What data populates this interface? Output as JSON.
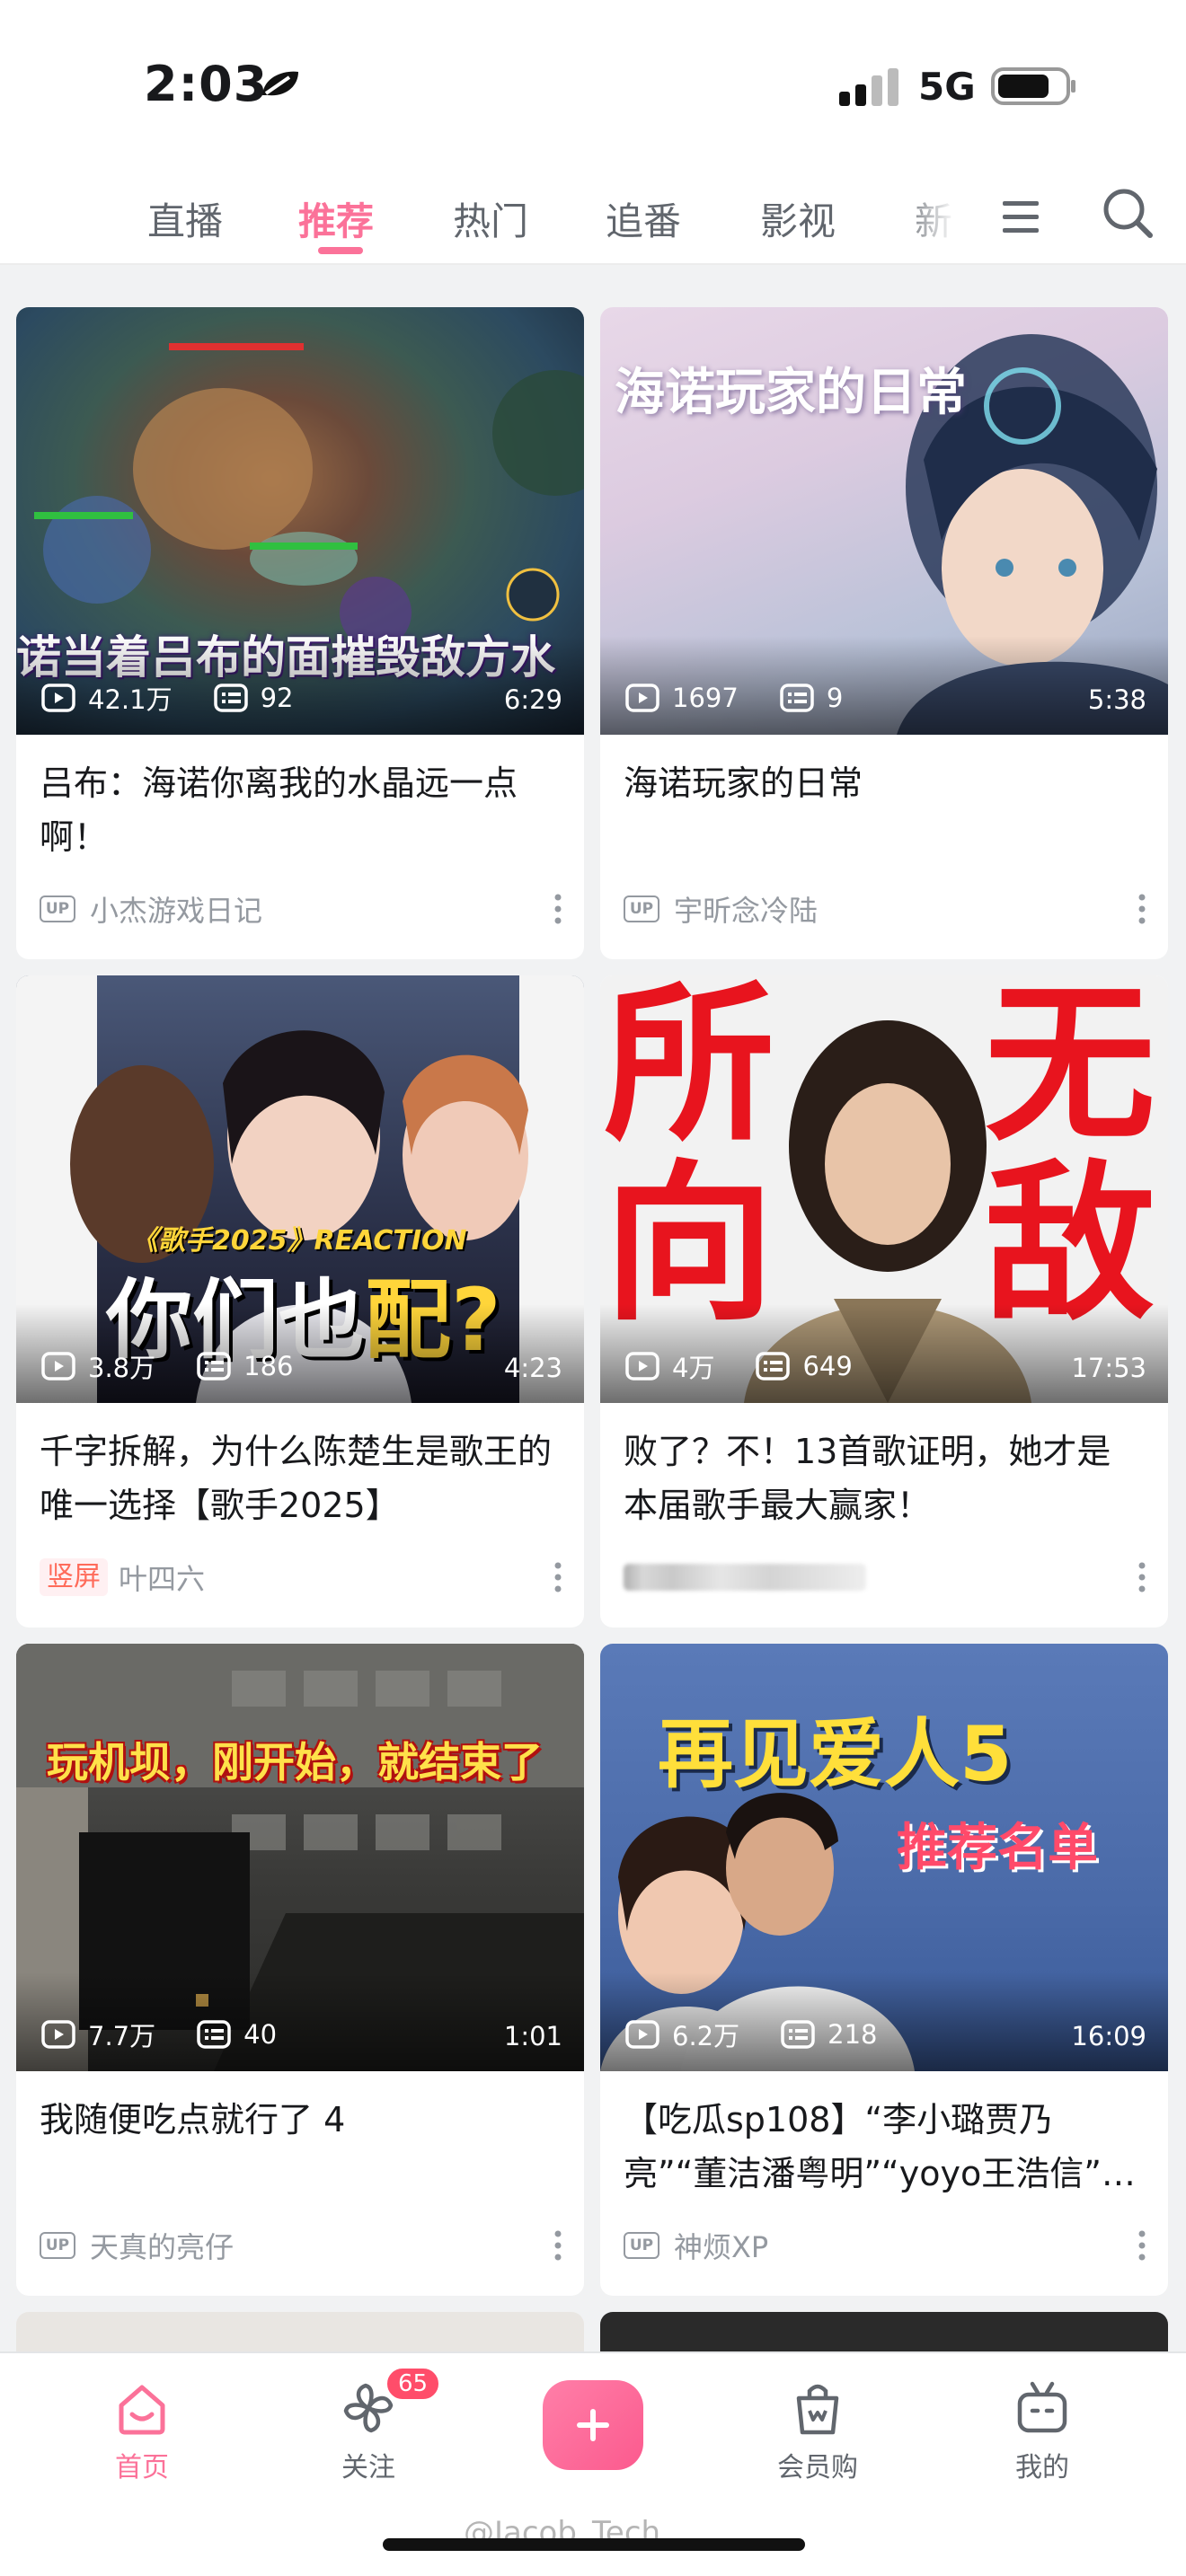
{
  "status_bar": {
    "time": "2:03",
    "network": "5G"
  },
  "top_nav": {
    "tabs": [
      {
        "label": "直播",
        "active": false
      },
      {
        "label": "推荐",
        "active": true
      },
      {
        "label": "热门",
        "active": false
      },
      {
        "label": "追番",
        "active": false
      },
      {
        "label": "影视",
        "active": false
      },
      {
        "label": "新",
        "active": false
      }
    ],
    "menu_icon": "hamburger-icon",
    "search_icon": "search-icon"
  },
  "cards": [
    {
      "views": "42.1万",
      "comments": "92",
      "duration": "6:29",
      "title": "吕布：海诺你离我的水晶远一点啊！",
      "author": "小杰游戏日记",
      "badge": "UP",
      "overlay_text": "诺当着吕布的面摧毁敌方水"
    },
    {
      "views": "1697",
      "comments": "9",
      "duration": "5:38",
      "title": "海诺玩家的日常",
      "author": "宇昕念冷陆",
      "badge": "UP",
      "overlay_text": "海诺玩家的日常"
    },
    {
      "views": "3.8万",
      "comments": "186",
      "duration": "4:23",
      "title": "千字拆解，为什么陈楚生是歌王的唯一选择【歌手2025】",
      "author": "叶四六",
      "badge": "竖屏",
      "overlay_small": "《歌手2025》REACTION",
      "overlay_big_a": "你们也",
      "overlay_big_b": "配?"
    },
    {
      "views": "4万",
      "comments": "649",
      "duration": "17:53",
      "title": "败了？不！13首歌证明，她才是本届歌手最大赢家！",
      "author": "",
      "badge": "",
      "overlay_left_1": "所",
      "overlay_left_2": "向",
      "overlay_right_1": "无",
      "overlay_right_2": "敌"
    },
    {
      "views": "7.7万",
      "comments": "40",
      "duration": "1:01",
      "title": "我随便吃点就行了 4",
      "author": "天真的亮仔",
      "badge": "UP",
      "overlay_text": "玩机坝，刚开始，就结束了"
    },
    {
      "views": "6.2万",
      "comments": "218",
      "duration": "16:09",
      "title": "【吃瓜sp108】“李小璐贾乃亮”“董洁潘粤明”“yoyo王浩信”…",
      "author": "神烦XP",
      "badge": "UP",
      "overlay_text_1": "再见爱人5",
      "overlay_text_2": "推荐名单"
    }
  ],
  "bottom_nav": {
    "items": [
      {
        "label": "首页",
        "icon": "home-icon",
        "active": true
      },
      {
        "label": "关注",
        "icon": "pinwheel-icon",
        "active": false
      },
      {
        "label": "会员购",
        "icon": "shopping-bag-icon",
        "active": false
      },
      {
        "label": "我的",
        "icon": "tv-icon",
        "active": false
      }
    ],
    "follow_badge": "65",
    "plus_icon": "plus-icon"
  },
  "watermark": "@Jacob_Tech",
  "colors": {
    "accent": "#fb7299",
    "text": "#18191c",
    "muted": "#9499a0"
  }
}
